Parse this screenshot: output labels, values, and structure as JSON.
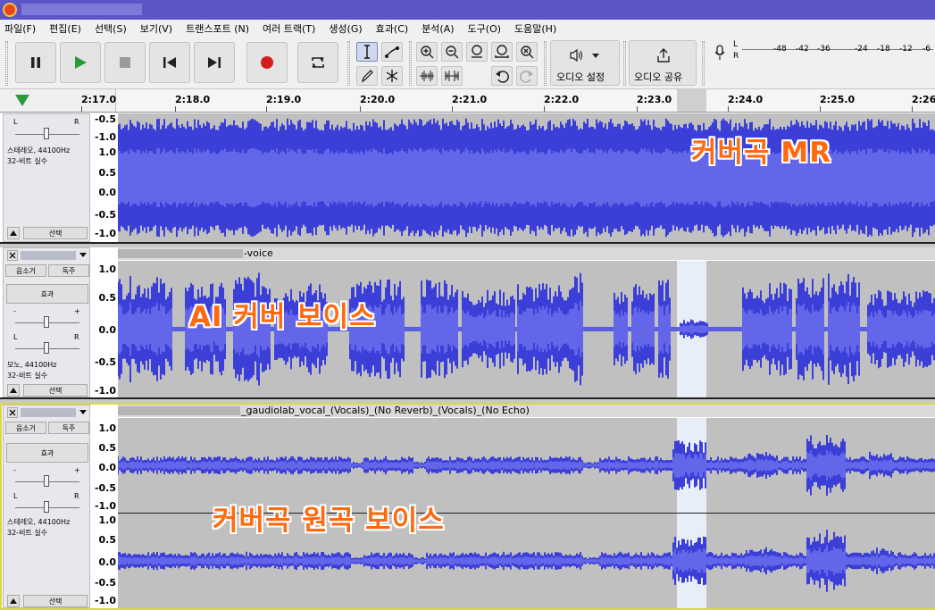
{
  "titlebar": {
    "icon": "audacity-icon"
  },
  "menu": [
    "파일(F)",
    "편집(E)",
    "선택(S)",
    "보기(V)",
    "트랜스포트 (N)",
    "여러 트랙(T)",
    "생성(G)",
    "효과(C)",
    "분석(A)",
    "도구(O)",
    "도움말(H)"
  ],
  "toolbar": {
    "audio_setup_label": "오디오 설정",
    "share_audio_label": "오디오 공유",
    "meter_channels": [
      "L",
      "R"
    ],
    "meter_ticks": [
      "-48",
      "-42",
      "-36",
      "-24",
      "-18",
      "-12",
      "-6"
    ]
  },
  "ruler": {
    "ticks": [
      "2:17.0",
      "2:18.0",
      "2:19.0",
      "2:20.0",
      "2:21.0",
      "2:22.0",
      "2:23.0",
      "2:24.0",
      "2:25.0",
      "2:26"
    ]
  },
  "tracks": [
    {
      "clip_name": "",
      "info_line1": "스테레오, 44100Hz",
      "info_line2": "32-비트 실수",
      "select_label": "선택",
      "scale_top": [
        "-0.5",
        "-1.0"
      ],
      "scale": [
        "1.0",
        "0.5",
        "0.0",
        "-0.5",
        "-1.0"
      ],
      "overlay": "커버곡 MR",
      "pan_left": "L",
      "pan_right": "R"
    },
    {
      "clip_name": "-voice",
      "mute_label": "음소거",
      "solo_label": "독주",
      "effects_label": "효과",
      "info_line1": "모노, 44100Hz",
      "info_line2": "32-비트 실수",
      "select_label": "선택",
      "scale": [
        "1.0",
        "0.5",
        "0.0",
        "-0.5",
        "-1.0"
      ],
      "overlay": "AI 커버 보이스",
      "gain_minus": "-",
      "gain_plus": "+",
      "pan_left": "L",
      "pan_right": "R"
    },
    {
      "clip_name": "_gaudiolab_vocal_(Vocals)_(No Reverb)_(Vocals)_(No Echo)",
      "mute_label": "음소거",
      "solo_label": "독주",
      "effects_label": "효과",
      "info_line1": "스테레오, 44100Hz",
      "info_line2": "32-비트 실수",
      "select_label": "선택",
      "scale_ch1": [
        "1.0",
        "0.5",
        "0.0",
        "-0.5",
        "-1.0"
      ],
      "scale_ch2": [
        "1.0",
        "0.5",
        "0.0",
        "-0.5",
        "-1.0"
      ],
      "overlay": "커버곡 원곡 보이스",
      "gain_minus": "-",
      "gain_plus": "+",
      "pan_left": "L",
      "pan_right": "R"
    }
  ],
  "colors": {
    "wave": "#3b3fd8",
    "wave_rms": "#6366e8",
    "track_bg": "#c0c0c0",
    "selection": "#e8eef8",
    "overlay_text": "#ff6a10"
  }
}
